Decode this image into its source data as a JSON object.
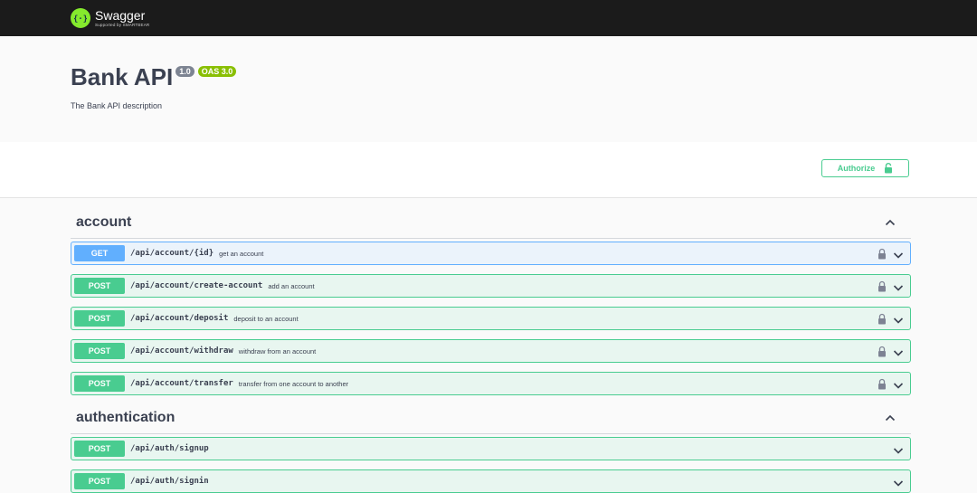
{
  "brand": {
    "name": "Swagger",
    "sub": "Supported by SMARTBEAR"
  },
  "info": {
    "title": "Bank API",
    "version": "1.0",
    "oas": "OAS 3.0",
    "description": "The Bank API description"
  },
  "auth": {
    "label": "Authorize"
  },
  "tags": [
    {
      "name": "account",
      "operations": [
        {
          "method": "GET",
          "path": "/api/account/{id}",
          "summary": "get an account",
          "locked": true
        },
        {
          "method": "POST",
          "path": "/api/account/create-account",
          "summary": "add an account",
          "locked": true
        },
        {
          "method": "POST",
          "path": "/api/account/deposit",
          "summary": "deposit to an account",
          "locked": true
        },
        {
          "method": "POST",
          "path": "/api/account/withdraw",
          "summary": "withdraw from an account",
          "locked": true
        },
        {
          "method": "POST",
          "path": "/api/account/transfer",
          "summary": "transfer from one account to another",
          "locked": true
        }
      ]
    },
    {
      "name": "authentication",
      "operations": [
        {
          "method": "POST",
          "path": "/api/auth/signup",
          "summary": "",
          "locked": false
        },
        {
          "method": "POST",
          "path": "/api/auth/signin",
          "summary": "",
          "locked": false
        }
      ]
    }
  ],
  "colors": {
    "get": "#61affe",
    "post": "#49cc90",
    "topbar": "#1b1b1b",
    "brand": "#85ea2d"
  }
}
